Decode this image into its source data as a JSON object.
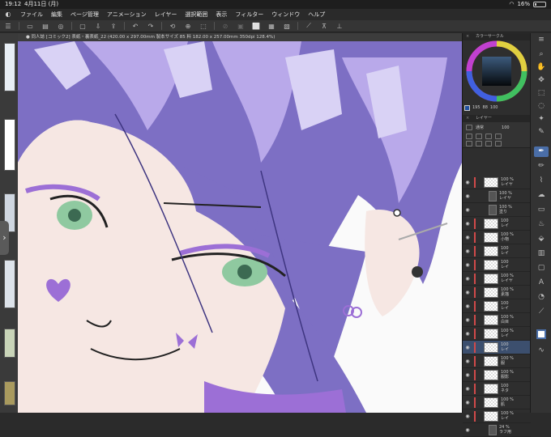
{
  "status": {
    "time": "19:12",
    "date": "4月11日 (月)",
    "battery": "16%",
    "battery_level": 0.16
  },
  "menu": [
    "ファイル",
    "編集",
    "ページ管理",
    "アニメーション",
    "レイヤー",
    "選択範囲",
    "表示",
    "フィルター",
    "ウィンドウ",
    "ヘルプ"
  ],
  "document_tab": "● 同人誌 [コミック2] 表紙・裏表紙_22 (420.00 x 297.00mm 製本サイズ 85 料 182.00 x 257.00mm 350dpi 128.4%)",
  "panels": {
    "color_title": "カラーサークル",
    "color_values": [
      "195",
      "88",
      "100"
    ],
    "layer_title": "レイヤー",
    "blend_mode": "通常",
    "opacity": "100"
  },
  "layers": [
    {
      "text": [
        "100 %",
        "レイヤ"
      ],
      "kind": "layer"
    },
    {
      "text": [
        "100 %",
        "レイヤ"
      ],
      "kind": "folder"
    },
    {
      "text": [
        "100 %",
        "塗り"
      ],
      "kind": "folder"
    },
    {
      "text": [
        "100",
        "レイ"
      ],
      "kind": "layer"
    },
    {
      "text": [
        "100 %",
        "小物"
      ],
      "kind": "layer"
    },
    {
      "text": [
        "100",
        "レイ"
      ],
      "kind": "layer"
    },
    {
      "text": [
        "100",
        "レイ"
      ],
      "kind": "layer"
    },
    {
      "text": [
        "100 %",
        "レイヤ"
      ],
      "kind": "layer"
    },
    {
      "text": [
        "100 %",
        "素描"
      ],
      "kind": "layer"
    },
    {
      "text": [
        "100",
        "レイ"
      ],
      "kind": "layer"
    },
    {
      "text": [
        "100 %",
        "白目"
      ],
      "kind": "layer"
    },
    {
      "text": [
        "100 %",
        "レイ"
      ],
      "kind": "layer"
    },
    {
      "text": [
        "100",
        "レイ"
      ],
      "kind": "selected"
    },
    {
      "text": [
        "100 %",
        "服"
      ],
      "kind": "layer"
    },
    {
      "text": [
        "100 %",
        "服影"
      ],
      "kind": "layer"
    },
    {
      "text": [
        "100",
        "ネタ"
      ],
      "kind": "layer"
    },
    {
      "text": [
        "100 %",
        "肌"
      ],
      "kind": "layer"
    },
    {
      "text": [
        "100 %",
        "レイ"
      ],
      "kind": "layer"
    },
    {
      "text": [
        "24 %",
        "ラフ用"
      ],
      "kind": "folder"
    }
  ],
  "colors": {
    "hair": "#7d6fc4",
    "hair_light": "#b9a9ea",
    "highlight": "#d9d2f5",
    "skin": "#f6e7e3",
    "eye": "#8fc9a0",
    "accent": "#9c6fd6"
  }
}
